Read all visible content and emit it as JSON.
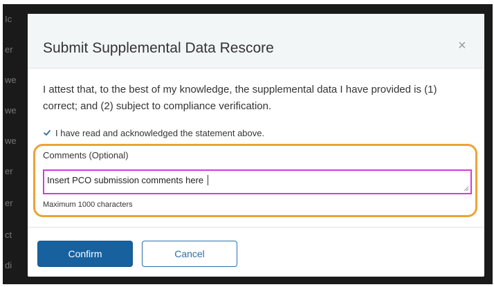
{
  "background": {
    "fragments": [
      "Ic",
      "er",
      "we",
      "we",
      "we",
      "er",
      "er",
      "ct",
      "di"
    ]
  },
  "modal": {
    "title": "Submit Supplemental Data Rescore",
    "close_label": "×",
    "attestation": "I attest that, to the best of my knowledge, the supplemental data I have provided is (1) correct; and (2) subject to compliance verification.",
    "acknowledge_label": "I have read and acknowledged the statement above.",
    "acknowledge_checked": true,
    "comments_label": "Comments (Optional)",
    "comments_value": "Insert PCO submission comments here",
    "comments_hint": "Maximum 1000 characters",
    "confirm_label": "Confirm",
    "cancel_label": "Cancel"
  },
  "colors": {
    "primary": "#17619f",
    "highlight": "#eba335",
    "input_focus": "#d23ad9"
  }
}
